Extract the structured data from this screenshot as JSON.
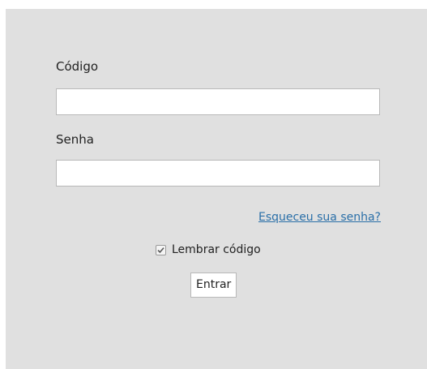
{
  "login_form": {
    "code_label": "Código",
    "code_value": "",
    "password_label": "Senha",
    "password_value": "",
    "forgot_password_link": "Esqueceu sua senha?",
    "remember_label": "Lembrar código",
    "remember_checked": true,
    "submit_label": "Entrar"
  },
  "icons": {
    "checkbox_mark": "checkmark-icon"
  },
  "colors": {
    "panel_background": "#e0e0e0",
    "link": "#2a6fa8",
    "input_border": "#b8b8b8"
  }
}
